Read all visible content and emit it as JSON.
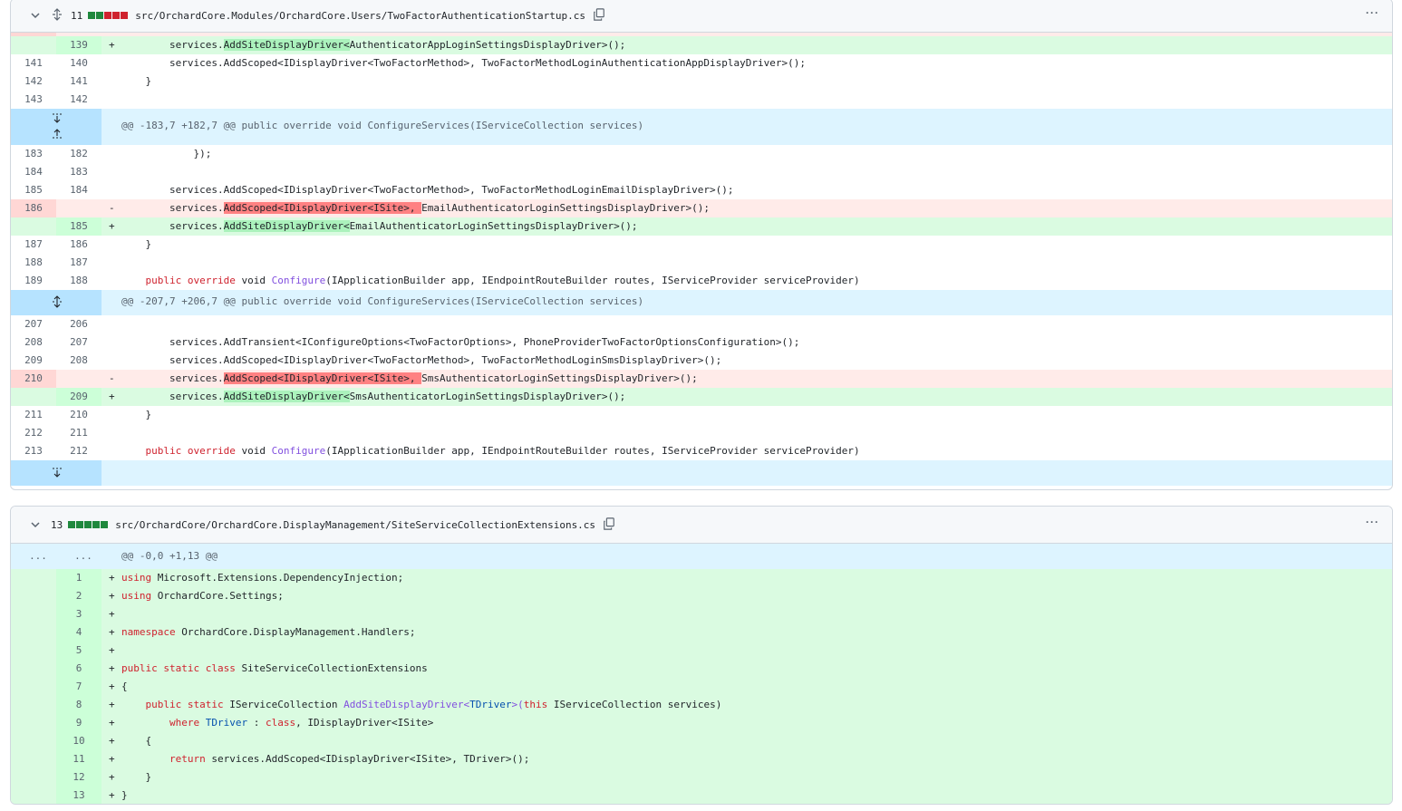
{
  "colors": {
    "add_bg": "#dafbe1",
    "del_bg": "#ffebe9",
    "hunk_bg": "#ddf4ff",
    "add_square": "#1f883d",
    "del_square": "#cf222e"
  },
  "file1": {
    "count": "11",
    "path": "src/OrchardCore.Modules/OrchardCore.Users/TwoFactorAuthenticationStartup.cs",
    "more_icon": "kebab-horizontal-icon",
    "hunk1": "@@ -183,7 +182,7 @@ public override void ConfigureServices(IServiceCollection services)",
    "hunk2": "@@ -207,7 +206,7 @@ public override void ConfigureServices(IServiceCollection services)",
    "lines": {
      "a0": {
        "l": "140",
        "r": ""
      },
      "a1": {
        "l": "",
        "r": "139",
        "m": "+"
      },
      "a2": {
        "l": "141",
        "r": "140",
        "c": "        services.AddScoped<IDisplayDriver<TwoFactorMethod>, TwoFactorMethodLoginAuthenticationAppDisplayDriver>();"
      },
      "a3": {
        "l": "142",
        "r": "141",
        "c": "    }"
      },
      "a4": {
        "l": "143",
        "r": "142",
        "c": ""
      },
      "b0": {
        "l": "183",
        "r": "182",
        "c": "            });"
      },
      "b1": {
        "l": "184",
        "r": "183",
        "c": ""
      },
      "b2": {
        "l": "185",
        "r": "184",
        "c": "        services.AddScoped<IDisplayDriver<TwoFactorMethod>, TwoFactorMethodLoginEmailDisplayDriver>();"
      },
      "b3": {
        "l": "186",
        "r": "",
        "m": "-"
      },
      "b4": {
        "l": "",
        "r": "185",
        "m": "+"
      },
      "b5": {
        "l": "187",
        "r": "186",
        "c": "    }"
      },
      "b6": {
        "l": "188",
        "r": "187",
        "c": ""
      },
      "b7": {
        "l": "189",
        "r": "188"
      },
      "c0": {
        "l": "207",
        "r": "206",
        "c": ""
      },
      "c1": {
        "l": "208",
        "r": "207",
        "c": "        services.AddTransient<IConfigureOptions<TwoFactorOptions>, PhoneProviderTwoFactorOptionsConfiguration>();"
      },
      "c2": {
        "l": "209",
        "r": "208",
        "c": "        services.AddScoped<IDisplayDriver<TwoFactorMethod>, TwoFactorMethodLoginSmsDisplayDriver>();"
      },
      "c3": {
        "l": "210",
        "r": "",
        "m": "-"
      },
      "c4": {
        "l": "",
        "r": "209",
        "m": "+"
      },
      "c5": {
        "l": "211",
        "r": "210",
        "c": "    }"
      },
      "c6": {
        "l": "212",
        "r": "211",
        "c": ""
      },
      "c7": {
        "l": "213",
        "r": "212"
      }
    },
    "frag": {
      "a1_pre": "        services.",
      "a1_hl": "AddSiteDisplayDriver<",
      "a1_post": "AuthenticatorAppLoginSettingsDisplayDriver>();",
      "b3_pre": "        services.",
      "b3_hl": "AddScoped<IDisplayDriver<ISite>, ",
      "b3_post": "EmailAuthenticatorLoginSettingsDisplayDriver>();",
      "b4_pre": "        services.",
      "b4_hl": "AddSiteDisplayDriver<",
      "b4_post": "EmailAuthenticatorLoginSettingsDisplayDriver>();",
      "c3_pre": "        services.",
      "c3_hl": "AddScoped<IDisplayDriver<ISite>, ",
      "c3_post": "SmsAuthenticatorLoginSettingsDisplayDriver>();",
      "c4_pre": "        services.",
      "c4_hl": "AddSiteDisplayDriver<",
      "c4_post": "SmsAuthenticatorLoginSettingsDisplayDriver>();",
      "cfg_indent": "    ",
      "cfg_public": "public",
      "cfg_override": "override",
      "cfg_void": " void ",
      "cfg_name": "Configure",
      "cfg_args": "(IApplicationBuilder app, IEndpointRouteBuilder routes, IServiceProvider serviceProvider)"
    }
  },
  "file2": {
    "count": "13",
    "path": "src/OrchardCore/OrchardCore.DisplayManagement/SiteServiceCollectionExtensions.cs",
    "dots": "...",
    "hunk": "@@ -0,0 +1,13 @@",
    "more_icon": "kebab-horizontal-icon",
    "ln": [
      "1",
      "2",
      "3",
      "4",
      "5",
      "6",
      "7",
      "8",
      "9",
      "10",
      "11",
      "12",
      "13"
    ],
    "marker": "+",
    "t": {
      "using": "using",
      "l1": " Microsoft.Extensions.DependencyInjection;",
      "l2": " OrchardCore.Settings;",
      "namespace": "namespace",
      "l4": " OrchardCore.DisplayManagement.Handlers;",
      "public": "public",
      "static": "static",
      "class": "class",
      "l6": " SiteServiceCollectionExtensions",
      "open": "{",
      "close": "}",
      "l8_type": " IServiceCollection ",
      "l8_fn": "AddSiteDisplayDriver<",
      "l8_tdriver": "TDriver",
      "l8_mid": ">(",
      "this": "this",
      "l8_end": " IServiceCollection services)",
      "where": "where",
      "l9_tdriver": "TDriver",
      "l9_end": " : ",
      "l9_tail": ", IDisplayDriver<ISite>",
      "return": "return",
      "l11": " services.AddScoped<IDisplayDriver<ISite>, TDriver>();"
    }
  }
}
